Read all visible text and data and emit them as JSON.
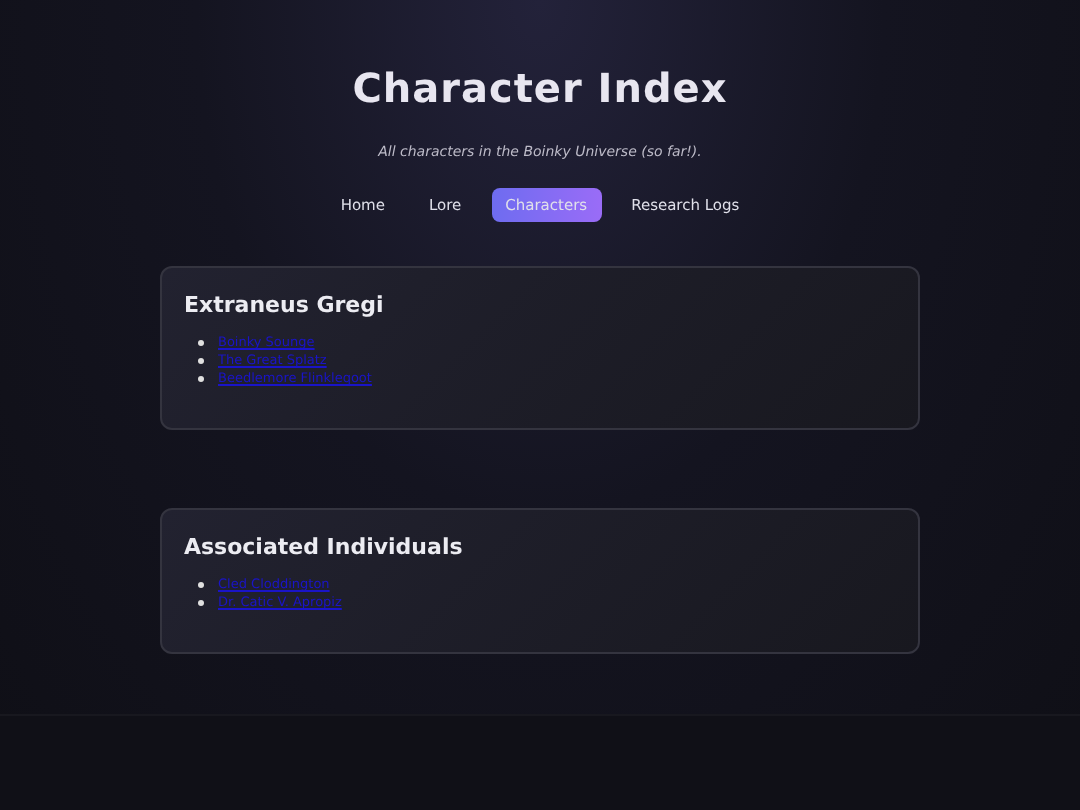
{
  "header": {
    "title": "Character Index",
    "subtitle": "All characters in the Boinky Universe (so far!)."
  },
  "nav": [
    {
      "label": "Home",
      "selected": false
    },
    {
      "label": "Lore",
      "selected": false
    },
    {
      "label": "Characters",
      "selected": true
    },
    {
      "label": "Research Logs",
      "selected": false
    }
  ],
  "sections": [
    {
      "title": "Extraneus Gregi",
      "links": [
        "Boinky Sounge",
        "The Great Splatz",
        "Beedlemore Flinkleqoot"
      ]
    },
    {
      "title": "Associated Individuals",
      "links": [
        "Cled Cloddington",
        "Dr. Catic V. Apropiz"
      ]
    }
  ]
}
